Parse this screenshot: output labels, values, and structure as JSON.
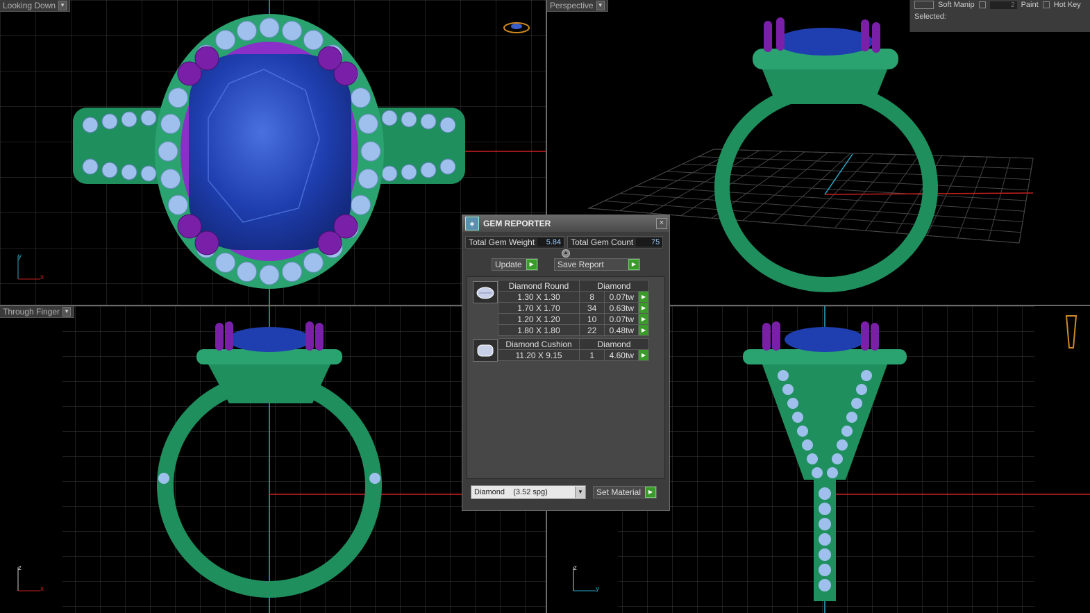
{
  "viewports": {
    "top_left": {
      "label": "Looking Down"
    },
    "top_right": {
      "label": "Perspective"
    },
    "bottom_left": {
      "label": "Through Finger"
    }
  },
  "axes": {
    "top_left": {
      "v": "y",
      "h": "x"
    },
    "bottom_left": {
      "v": "z",
      "h": "x"
    },
    "bottom_right": {
      "v": "z",
      "h": "y"
    }
  },
  "toolbar": {
    "soft_manip": "Soft Manip",
    "value": "2",
    "paint": "Paint",
    "hot_key": "Hot Key",
    "selected": "Selected:"
  },
  "gem_reporter": {
    "title": "GEM REPORTER",
    "total_weight_label": "Total Gem Weight",
    "total_weight": "5.84",
    "total_count_label": "Total Gem Count",
    "total_count": "75",
    "update_label": "Update",
    "save_report_label": "Save Report",
    "groups": [
      {
        "shape": "Diamond Round",
        "material": "Diamond",
        "rows": [
          {
            "size": "1.30 X 1.30",
            "count": "8",
            "weight": "0.07tw"
          },
          {
            "size": "1.70 X 1.70",
            "count": "34",
            "weight": "0.63tw"
          },
          {
            "size": "1.20 X 1.20",
            "count": "10",
            "weight": "0.07tw"
          },
          {
            "size": "1.80 X 1.80",
            "count": "22",
            "weight": "0.48tw"
          }
        ]
      },
      {
        "shape": "Diamond Cushion",
        "material": "Diamond",
        "rows": [
          {
            "size": "11.20 X 9.15",
            "count": "1",
            "weight": "4.60tw"
          }
        ]
      }
    ],
    "material_select": "Diamond    (3.52 spg)",
    "set_material_label": "Set Material"
  },
  "colors": {
    "metal": "#1f8f5e",
    "halo_metal": "#2aa370",
    "center_stone": "#1f3fb0",
    "accent_stone": "#9fc0ec",
    "prong": "#7a1fa8",
    "grid": "#3c3c3c",
    "axis_red": "#c82020",
    "axis_cyan": "#2aa8c8"
  }
}
